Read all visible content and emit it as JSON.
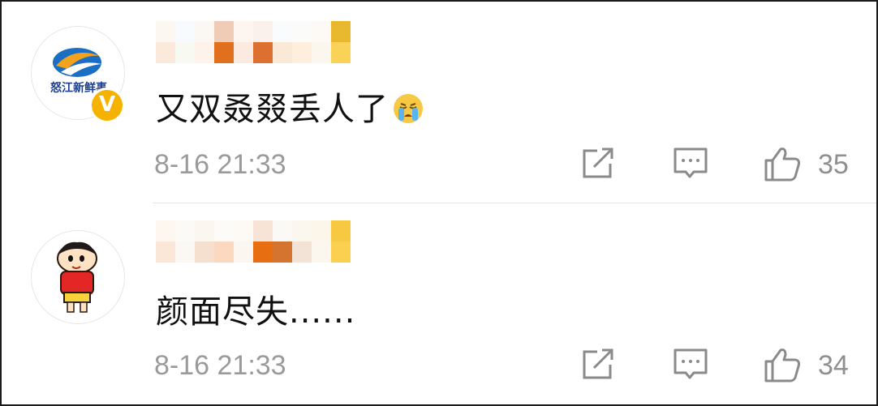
{
  "comments": [
    {
      "verified": true,
      "avatar_logo_text": "怒江新鲜事",
      "verified_badge": "V",
      "text": "又双叒叕丢人了",
      "emoji": "crying-face",
      "time": "8-16 21:33",
      "likes": "35"
    },
    {
      "verified": false,
      "text": "颜面尽失......",
      "time": "8-16 21:33",
      "likes": "34"
    }
  ],
  "colors": {
    "accent_orange": "#e07020",
    "badge_gold": "#f5b300",
    "meta_gray": "#9a9a9a"
  },
  "icons": [
    "share-icon",
    "comment-icon",
    "thumbs-up-icon"
  ]
}
